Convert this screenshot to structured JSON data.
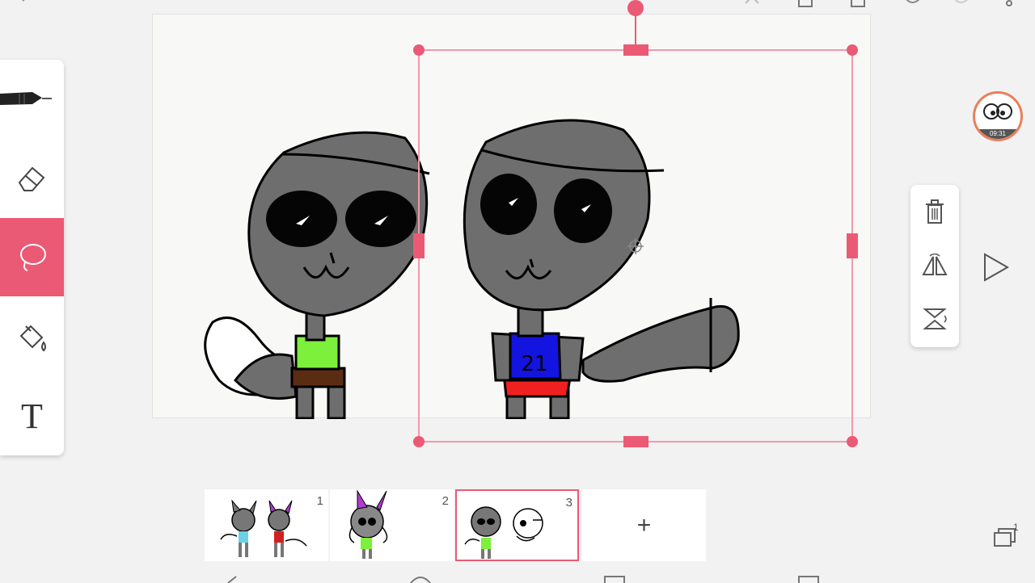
{
  "app": {
    "accent_color": "#ea5a74",
    "canvas_color": "#f8f8f7"
  },
  "toolbar": {
    "icons": [
      "back-icon",
      "eraser-small-icon",
      "copy-icon",
      "paste-icon",
      "undo-icon",
      "redo-icon",
      "more-icon"
    ]
  },
  "tools": [
    {
      "name": "pen",
      "icon": "pen-icon",
      "active": false
    },
    {
      "name": "eraser",
      "icon": "eraser-icon",
      "active": false
    },
    {
      "name": "lasso",
      "icon": "lasso-icon",
      "active": true
    },
    {
      "name": "fill",
      "icon": "paint-bucket-icon",
      "active": false
    },
    {
      "name": "text",
      "icon": "text-icon",
      "label": "T",
      "active": false
    }
  ],
  "selection_menu": {
    "items": [
      "delete-icon",
      "flip-horizontal-icon",
      "flip-vertical-icon"
    ]
  },
  "timer_avatar": {
    "time": "09:31"
  },
  "frames": [
    {
      "number": "1",
      "active": false
    },
    {
      "number": "2",
      "active": false
    },
    {
      "number": "3",
      "active": true
    }
  ],
  "add_frame": {
    "label": "+"
  },
  "layers": {
    "count": "1"
  },
  "drawing": {
    "jersey_number": "21"
  }
}
